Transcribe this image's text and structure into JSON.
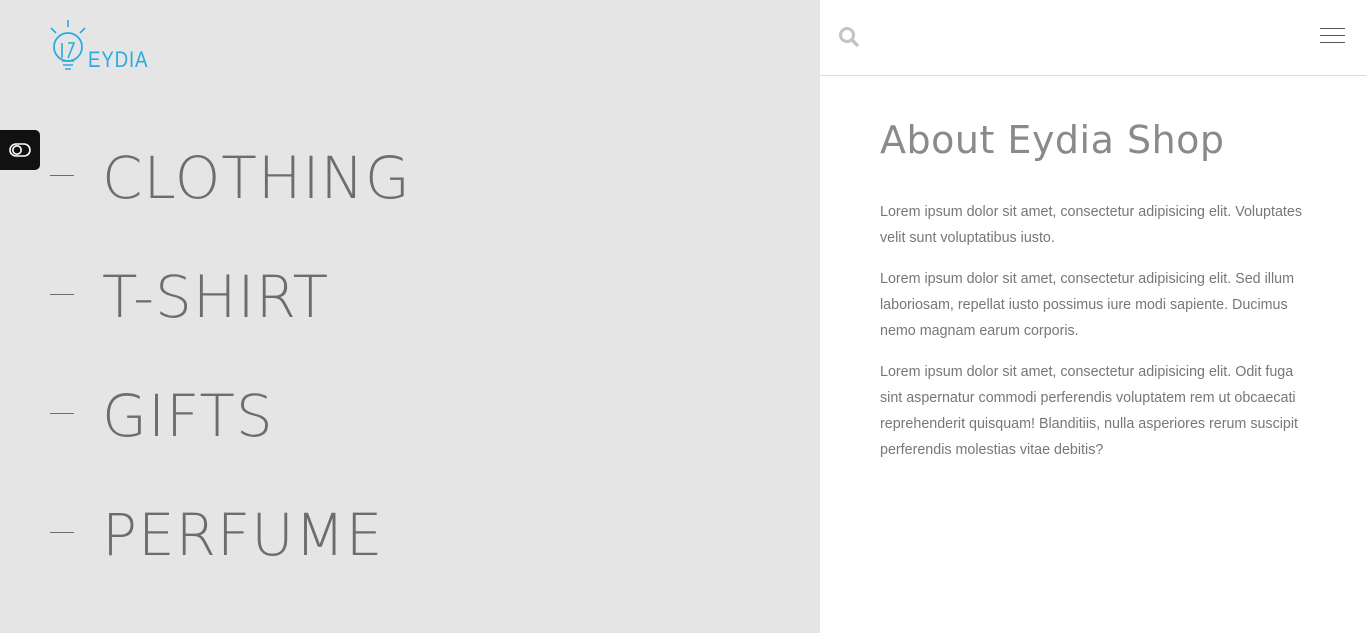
{
  "brand": {
    "name": "EYDIA",
    "color": "#29abe2",
    "icon": "lightbulb-logo-icon"
  },
  "toggle": {
    "icon": "toggle-switch-icon"
  },
  "categories": [
    {
      "label": "CLOTHING"
    },
    {
      "label": "T-SHIRT"
    },
    {
      "label": "GIFTS"
    },
    {
      "label": "PERFUME"
    }
  ],
  "header": {
    "search_icon": "search-icon",
    "menu_icon": "hamburger-menu-icon"
  },
  "about": {
    "title": "About Eydia Shop",
    "paragraphs": [
      "Lorem ipsum dolor sit amet, consectetur adipisicing elit. Voluptates velit sunt voluptatibus iusto.",
      "Lorem ipsum dolor sit amet, consectetur adipisicing elit. Sed illum laboriosam, repellat iusto possimus iure modi sapiente. Ducimus nemo magnam earum corporis.",
      "Lorem ipsum dolor sit amet, consectetur adipisicing elit. Odit fuga sint aspernatur commodi perferendis voluptatem rem ut obcaecati reprehenderit quisquam! Blanditiis, nulla asperiores rerum suscipit perferendis molestias vitae debitis?"
    ]
  },
  "colors": {
    "left_panel": "#e5e5e5",
    "text_gray": "#6d6d6d",
    "toggle_bg": "#111111"
  }
}
